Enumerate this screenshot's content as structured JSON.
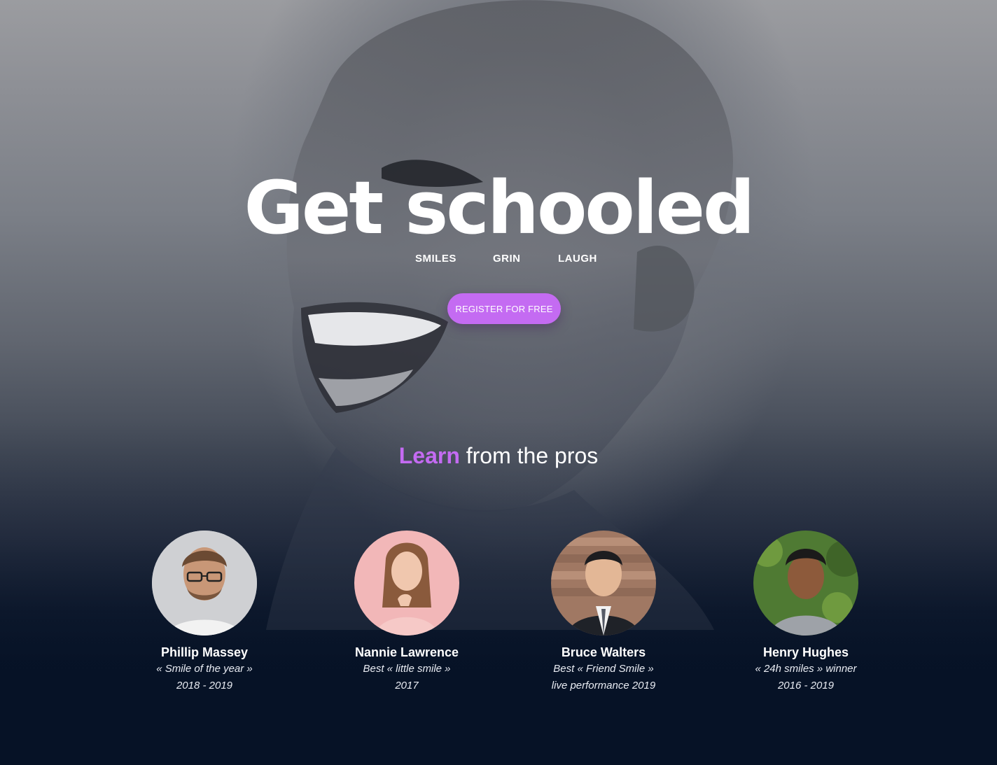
{
  "hero": {
    "title": "Get schooled",
    "taglines": [
      "SMILES",
      "GRIN",
      "LAUGH"
    ],
    "cta_label": "REGISTER FOR FREE"
  },
  "pros_section": {
    "heading_accent": "Learn",
    "heading_rest": " from the pros",
    "pros": [
      {
        "name": "Phillip Massey",
        "line1": "« Smile of the year »",
        "line2": "2018 - 2019"
      },
      {
        "name": "Nannie Lawrence",
        "line1": "Best « little smile »",
        "line2": "2017"
      },
      {
        "name": "Bruce Walters",
        "line1": "Best « Friend Smile »",
        "line2": "live performance 2019"
      },
      {
        "name": "Henry Hughes",
        "line1": "« 24h smiles » winner",
        "line2": "2016 - 2019"
      }
    ]
  },
  "colors": {
    "accent": "#c46bf2",
    "background_dark": "#061226",
    "text": "#ffffff"
  }
}
